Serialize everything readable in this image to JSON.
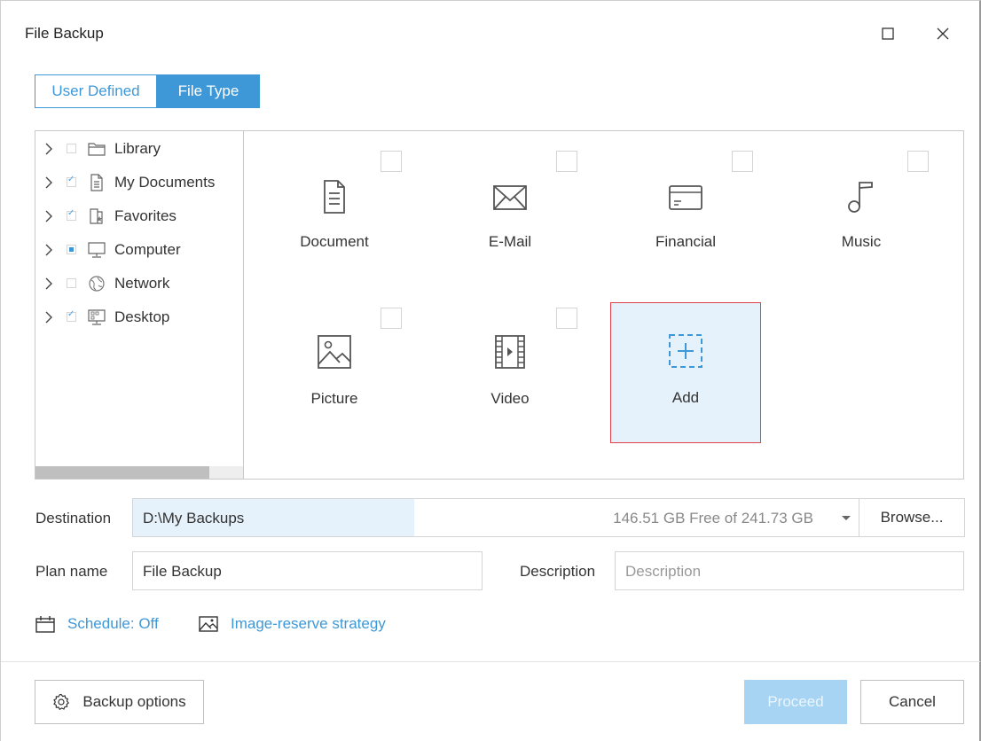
{
  "window": {
    "title": "File Backup"
  },
  "mode_tabs": {
    "user_defined": "User Defined",
    "file_type": "File Type",
    "selected": "File Type"
  },
  "tree": {
    "items": [
      {
        "label": "Library",
        "check": "unchecked",
        "icon": "folder-icon"
      },
      {
        "label": "My Documents",
        "check": "checked",
        "icon": "document-icon"
      },
      {
        "label": "Favorites",
        "check": "checked",
        "icon": "favorites-icon"
      },
      {
        "label": "Computer",
        "check": "partial",
        "icon": "computer-icon"
      },
      {
        "label": "Network",
        "check": "unchecked",
        "icon": "network-icon"
      },
      {
        "label": "Desktop",
        "check": "checked",
        "icon": "desktop-icon"
      }
    ]
  },
  "file_types": {
    "document": "Document",
    "email": "E-Mail",
    "financial": "Financial",
    "music": "Music",
    "picture": "Picture",
    "video": "Video",
    "add": "Add"
  },
  "destination": {
    "label": "Destination",
    "path": "D:\\My Backups",
    "free_space": "146.51 GB Free of 241.73 GB",
    "browse": "Browse..."
  },
  "plan": {
    "name_label": "Plan name",
    "name_value": "File Backup",
    "description_label": "Description",
    "description_placeholder": "Description"
  },
  "links": {
    "schedule": "Schedule: Off",
    "image_reserve": "Image-reserve strategy"
  },
  "footer": {
    "backup_options": "Backup options",
    "proceed": "Proceed",
    "cancel": "Cancel"
  },
  "colors": {
    "accent": "#3e98d8",
    "selected_bg": "#e6f2fb",
    "highlight_border": "#e0404a",
    "disabled_btn": "#a7d4f2"
  }
}
